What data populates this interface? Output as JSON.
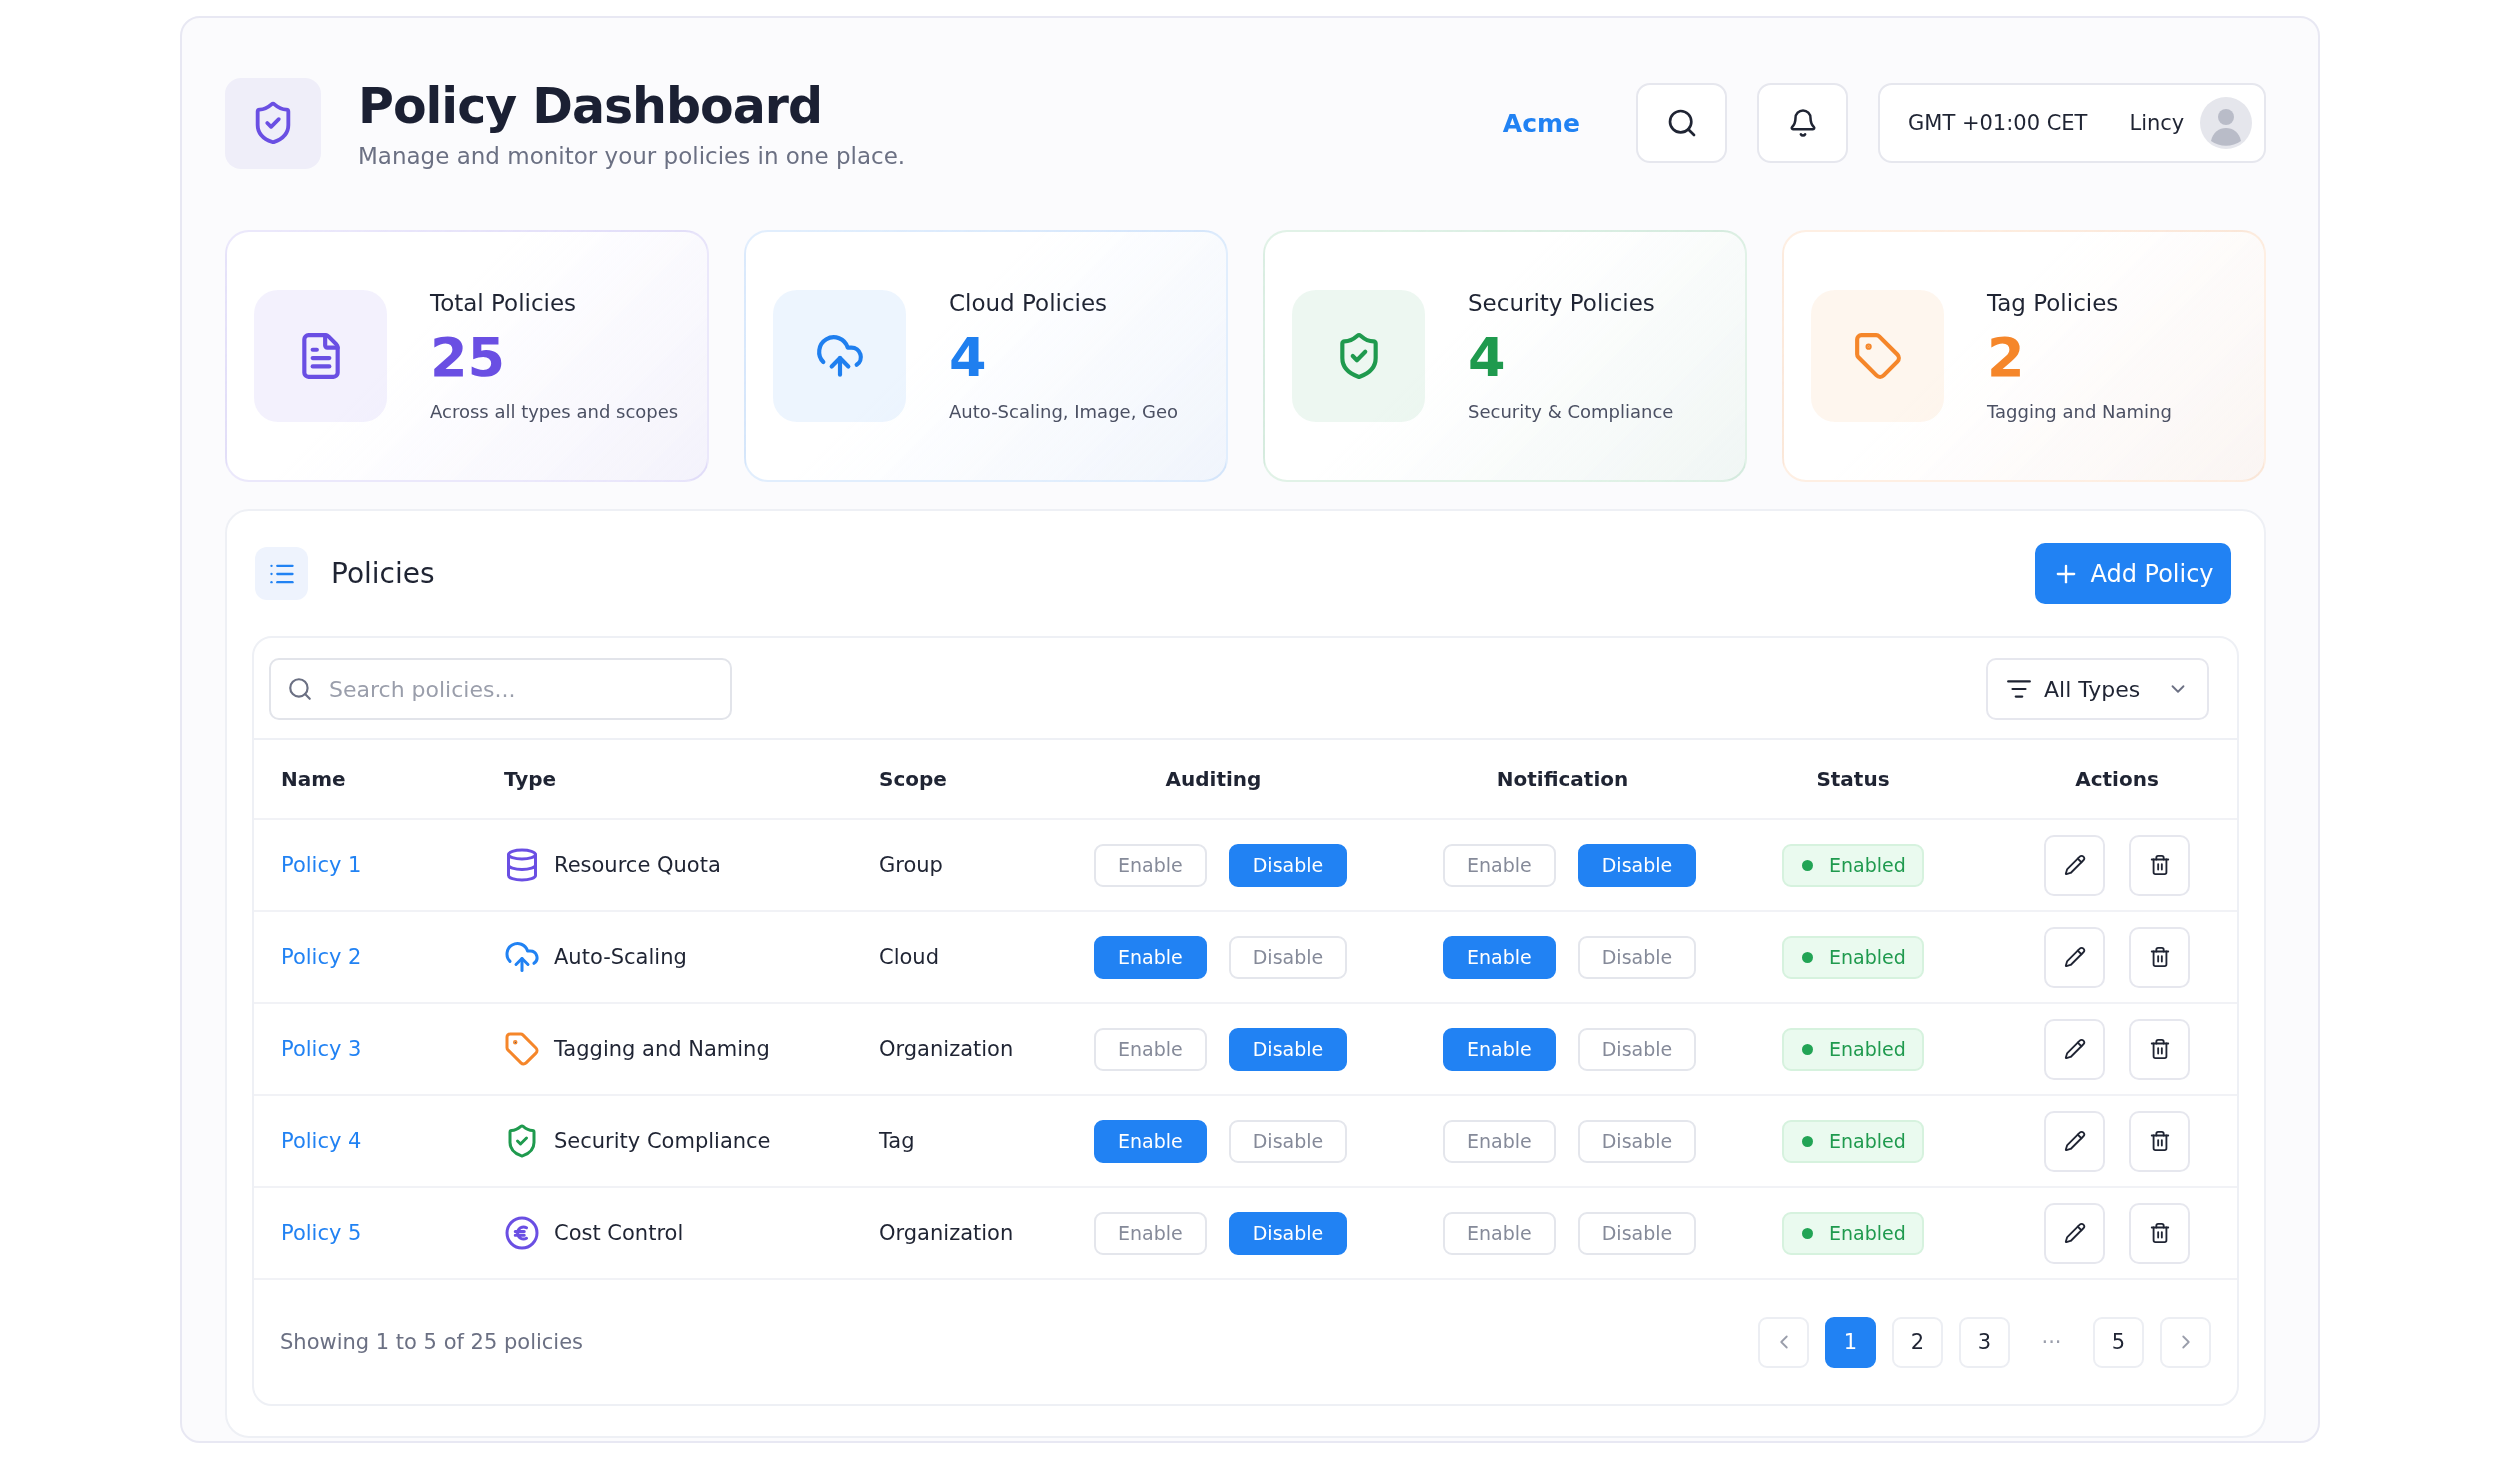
{
  "header": {
    "title": "Policy Dashboard",
    "subtitle": "Manage and monitor your policies in one place.",
    "org": "Acme",
    "timezone": "GMT +01:00 CET",
    "user": "Lincy"
  },
  "stats": [
    {
      "kind": "document",
      "title": "Total Policies",
      "value": "25",
      "caption": "Across all types and scopes",
      "color": "#6a4fe3"
    },
    {
      "kind": "cloud",
      "title": "Cloud Policies",
      "value": "4",
      "caption": "Auto-Scaling, Image, Geo",
      "color": "#1f7fef"
    },
    {
      "kind": "shield",
      "title": "Security Policies",
      "value": "4",
      "caption": "Security & Compliance",
      "color": "#1f9a4e"
    },
    {
      "kind": "tag",
      "title": "Tag Policies",
      "value": "2",
      "caption": "Tagging and Naming",
      "color": "#f5862a"
    }
  ],
  "policies": {
    "title": "Policies",
    "add_button": "Add Policy",
    "search": {
      "placeholder": "Search policies..."
    },
    "filter": "All Types",
    "columns": [
      "Name",
      "Type",
      "Scope",
      "Auditing",
      "Notification",
      "Status",
      "Actions"
    ],
    "rows": [
      {
        "name": "Policy 1",
        "kind": "database",
        "type": "Resource Quota",
        "scope": "Group",
        "auditing": [
          {
            "label": "Enable",
            "selected": false
          },
          {
            "label": "Disable",
            "selected": true
          }
        ],
        "notification": [
          {
            "label": "Enable",
            "selected": false
          },
          {
            "label": "Disable",
            "selected": true
          }
        ],
        "status": "Enabled"
      },
      {
        "name": "Policy 2",
        "kind": "cloud",
        "type": "Auto-Scaling",
        "scope": "Cloud",
        "auditing": [
          {
            "label": "Enable",
            "selected": true
          },
          {
            "label": "Disable",
            "selected": false
          }
        ],
        "notification": [
          {
            "label": "Enable",
            "selected": true
          },
          {
            "label": "Disable",
            "selected": false
          }
        ],
        "status": "Enabled"
      },
      {
        "name": "Policy 3",
        "kind": "tag",
        "type": "Tagging and Naming",
        "scope": "Organization",
        "auditing": [
          {
            "label": "Enable",
            "selected": false
          },
          {
            "label": "Disable",
            "selected": true
          }
        ],
        "notification": [
          {
            "label": "Enable",
            "selected": true
          },
          {
            "label": "Disable",
            "selected": false
          }
        ],
        "status": "Enabled"
      },
      {
        "name": "Policy 4",
        "kind": "shield",
        "type": "Security Compliance",
        "scope": "Tag",
        "auditing": [
          {
            "label": "Enable",
            "selected": true
          },
          {
            "label": "Disable",
            "selected": false
          }
        ],
        "notification": [
          {
            "label": "Enable",
            "selected": false
          },
          {
            "label": "Disable",
            "selected": false
          }
        ],
        "status": "Enabled"
      },
      {
        "name": "Policy 5",
        "kind": "euro",
        "type": "Cost Control",
        "scope": "Organization",
        "auditing": [
          {
            "label": "Enable",
            "selected": false
          },
          {
            "label": "Disable",
            "selected": true
          }
        ],
        "notification": [
          {
            "label": "Enable",
            "selected": false
          },
          {
            "label": "Disable",
            "selected": false
          }
        ],
        "status": "Enabled"
      }
    ],
    "summary": "Showing 1 to 5 of 25 policies",
    "pages": [
      {
        "kind": "page",
        "label": "1",
        "selected": true
      },
      {
        "kind": "page",
        "label": "2",
        "selected": false
      },
      {
        "kind": "page",
        "label": "3",
        "selected": false
      },
      {
        "kind": "ellipsis",
        "label": "···"
      },
      {
        "kind": "page",
        "label": "5",
        "selected": false
      }
    ]
  }
}
